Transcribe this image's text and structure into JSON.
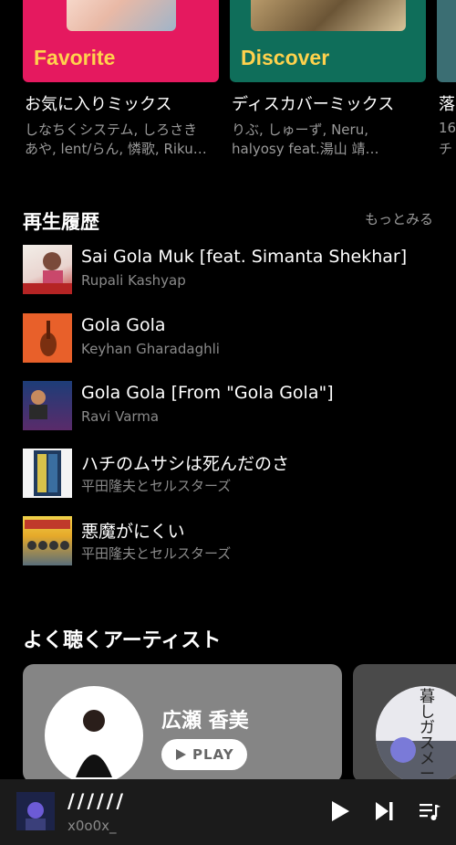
{
  "mixes": [
    {
      "cover_label": "Favorite",
      "title": "お気に入りミックス",
      "line1": "しなちくシステム, しろさき",
      "line2": "あや, lent/らん, 憐歌, Riku…",
      "color": "#e5195f"
    },
    {
      "cover_label": "Discover",
      "title": "ディスカバーミックス",
      "line1": "りぶ, しゅーず, Neru,",
      "line2": "halyosy feat.湯山 靖…",
      "color": "#0f6e5a"
    },
    {
      "cover_label": "",
      "title": "落",
      "line1": "16",
      "line2": "チ",
      "color": "#3b6e73"
    }
  ],
  "history": {
    "title": "再生履歴",
    "more_label": "もっとみる",
    "items": [
      {
        "title": "Sai Gola Muk [feat. Simanta Shekhar]",
        "artist": "Rupali Kashyap",
        "thumb_text": "BEST OF RUPALI KASHYAP"
      },
      {
        "title": "Gola Gola",
        "artist": "Keyhan Gharadaghli",
        "thumb_text": "VOROLOGIE"
      },
      {
        "title": "Gola Gola [From \"Gola Gola\"]",
        "artist": "Ravi Varma",
        "thumb_text": "Ravi Varma",
        "thumb_text2": "Popular Hitz"
      },
      {
        "title": "ハチのムサシは死んだのさ",
        "artist": "平田隆夫とセルスターズ",
        "thumb_text": ""
      },
      {
        "title": "悪魔がにくい",
        "artist": "平田隆夫とセルスターズ",
        "thumb_text": "平田隆夫とセルスターズ"
      }
    ]
  },
  "artists": {
    "title": "よく聴くアーティスト",
    "cards": [
      {
        "name": "広瀬 香美",
        "play_label": "PLAY"
      },
      {
        "name": "",
        "art_text": "暮しガスメータ"
      }
    ]
  },
  "player": {
    "title": "//////",
    "artist": "x0o0x_",
    "icons": [
      "play-icon",
      "skip-next-icon",
      "queue-icon"
    ]
  }
}
